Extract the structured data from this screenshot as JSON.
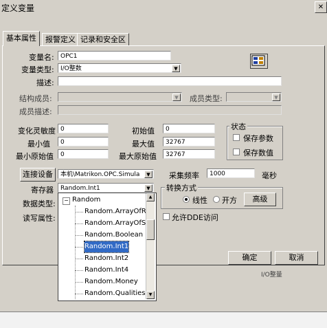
{
  "window": {
    "title": "定义变量",
    "close_glyph": "✕"
  },
  "tabs": [
    {
      "label": "基本属性"
    },
    {
      "label": "报警定义"
    },
    {
      "label": "记录和安全区"
    }
  ],
  "form": {
    "var_name_label": "变量名:",
    "var_name_value": "OPC1",
    "var_type_label": "变量类型:",
    "var_type_value": "I/O整数",
    "desc_label": "描述:",
    "desc_value": "",
    "struct_member_label": "结构成员:",
    "struct_member_value": "",
    "member_type_label": "成员类型:",
    "member_type_value": "",
    "member_desc_label": "成员描述:",
    "member_desc_value": "",
    "sensitivity_label": "变化灵敏度",
    "sensitivity_value": "0",
    "initial_label": "初始值",
    "initial_value": "0",
    "min_label": "最小值",
    "min_value": "0",
    "max_label": "最大值",
    "max_value": "32767",
    "min_raw_label": "最小原始值",
    "min_raw_value": "0",
    "max_raw_label": "最大原始值",
    "max_raw_value": "32767",
    "status_group_label": "状态",
    "save_params_label": "保存参数",
    "save_value_label": "保存数值",
    "connect_device_button": "连接设备",
    "device_value": "本机\\Matrikon.OPC.Simula",
    "sample_rate_label": "采集频率",
    "sample_rate_value": "1000",
    "sample_rate_unit": "毫秒",
    "register_label": "寄存器",
    "register_value": "Random.Int1",
    "data_type_label": "数据类型:",
    "rw_attr_label": "读写属性:",
    "convert_group_label": "转换方式",
    "linear_label": "线性",
    "sqrt_label": "开方",
    "advanced_button": "高级",
    "allow_dde_label": "允许DDE访问",
    "ok_button": "确定",
    "cancel_button": "取消",
    "partial_text": "I/O整量"
  },
  "dropdown": {
    "root_label": "Random",
    "expand_glyph": "⊟",
    "items": [
      {
        "label": "Random.ArrayOfR"
      },
      {
        "label": "Random.ArrayOfS"
      },
      {
        "label": "Random.Boolean"
      },
      {
        "label": "Random.Int1"
      },
      {
        "label": "Random.Int2"
      },
      {
        "label": "Random.Int4"
      },
      {
        "label": "Random.Money"
      },
      {
        "label": "Random.Qualities"
      }
    ],
    "selected_index": 3
  },
  "icons": {
    "dropdown_arrow": "▼",
    "scroll_up": "▲",
    "scroll_down": "▼"
  }
}
